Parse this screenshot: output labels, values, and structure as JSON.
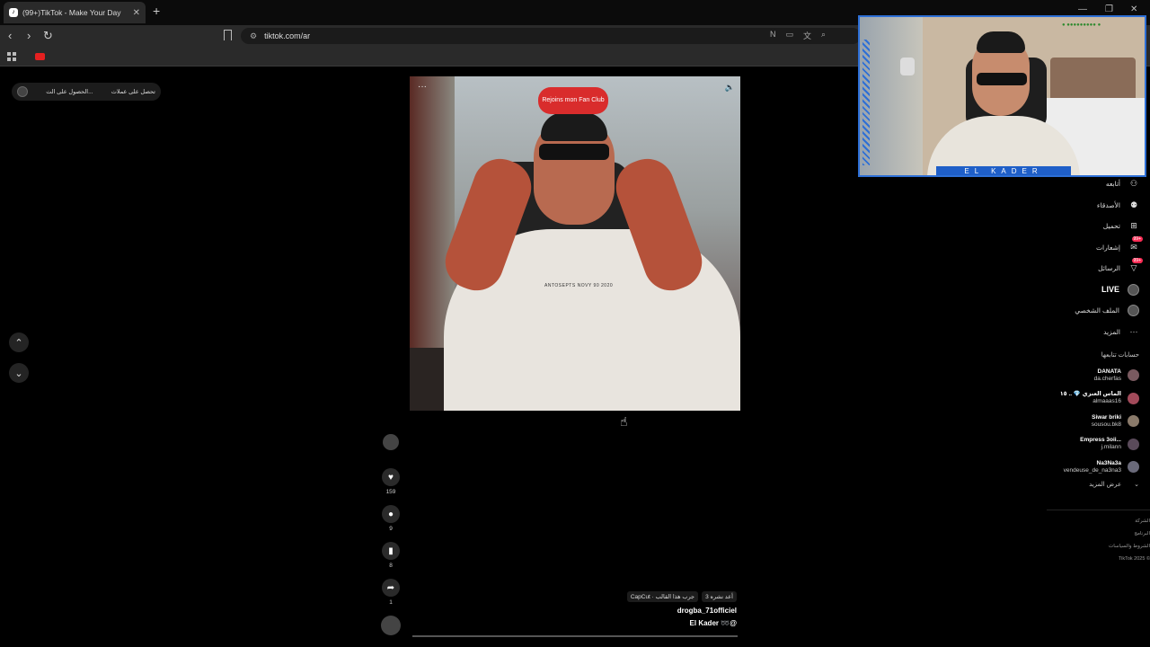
{
  "browser": {
    "tab_title": "(99+)TikTok - Make Your Day",
    "url": "tiktok.com/ar",
    "new_tab": "+"
  },
  "promo": {
    "text_right": "تحصل على عملات",
    "text_left": "الحصول على الت..."
  },
  "video": {
    "fanclub_badge": "Rejoins mon Fan Club",
    "shirt_text": "ANTOSEPTS NOVY 90 2020"
  },
  "actions": {
    "likes": "159",
    "comments": "9",
    "saves": "8",
    "shares": "1"
  },
  "video_info": {
    "chip_effect": "3 أعد نشره",
    "chip_capcut": "CapCut · جرب هذا القالب",
    "username": "drogba_71officiel",
    "caption": "El Kader ➿@"
  },
  "sidebar": {
    "nav": [
      {
        "label": "أتابعه",
        "icon": "user-plus-icon"
      },
      {
        "label": "الأصدقاء",
        "icon": "friends-icon"
      },
      {
        "label": "تحميل",
        "icon": "upload-icon"
      },
      {
        "label": "إشعارات",
        "icon": "inbox-icon",
        "badge": "99+"
      },
      {
        "label": "الرسائل",
        "icon": "messages-icon",
        "badge": "99+"
      },
      {
        "label": "LIVE",
        "icon": "live-icon"
      },
      {
        "label": "الملف الشخصي",
        "icon": "profile-avatar-icon"
      },
      {
        "label": "المزيد",
        "icon": "more-icon"
      }
    ],
    "following_title": "حسابات تتابعها",
    "following": [
      {
        "display": "DANATA",
        "user": "da.cherfas"
      },
      {
        "display": "الماس العنزي 💎 .. ١٥",
        "user": "almaaas16"
      },
      {
        "display": "Siwar briki",
        "user": "sousou.bk8"
      },
      {
        "display": "Empress 3oii...",
        "user": "j.milann"
      },
      {
        "display": "Na3Na3a",
        "user": "vendeuse_de_na3na3"
      }
    ],
    "see_more": "عرض المزيد",
    "footer": [
      "الشركة",
      "البرنامج",
      "الشروط والسياسات",
      "TikTok 2025 ©"
    ]
  },
  "webcam": {
    "name_band": "EL KADER",
    "tag": "● ●●●●●●●●● ●"
  }
}
